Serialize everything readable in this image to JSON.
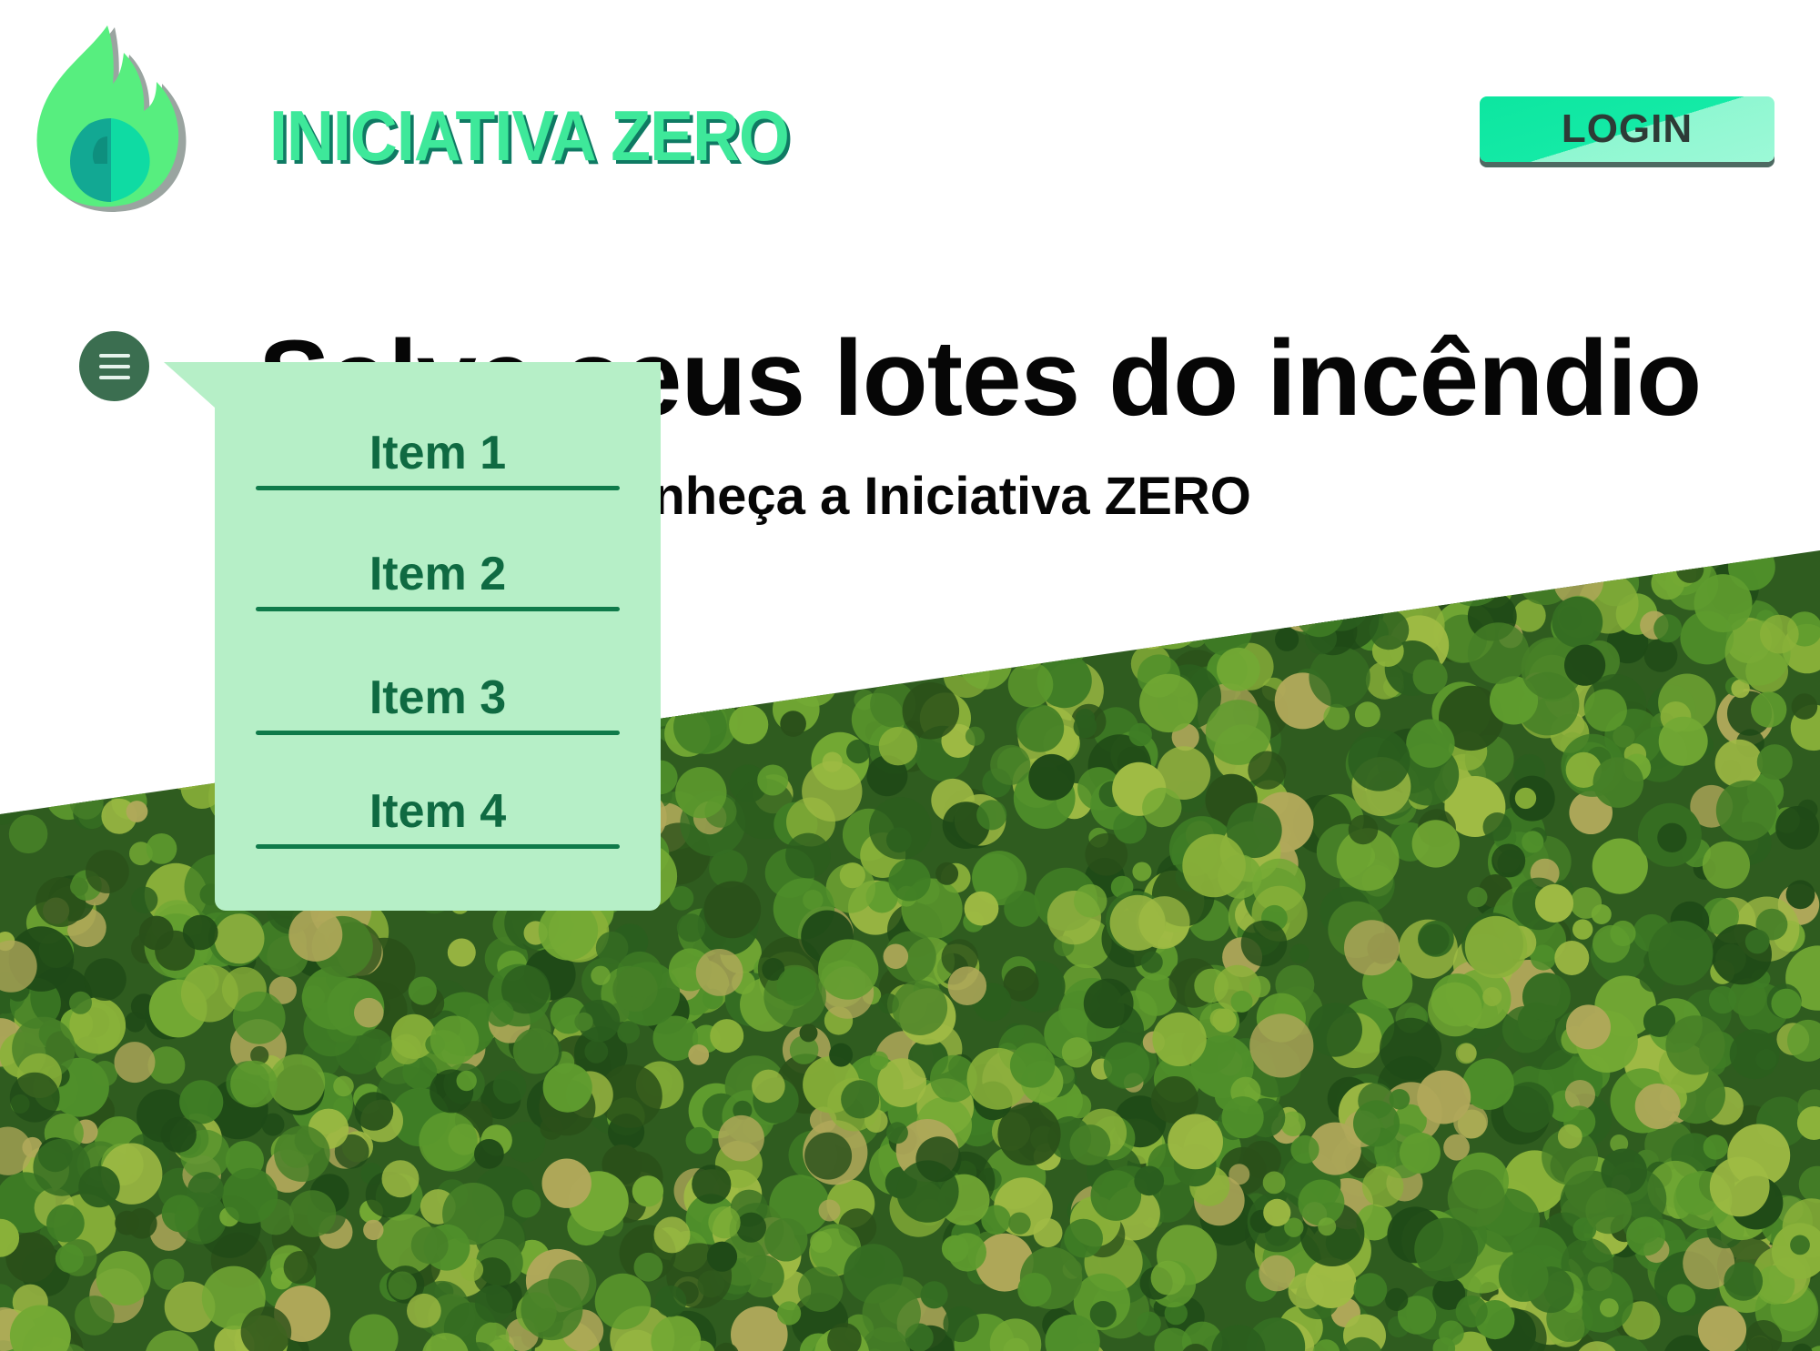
{
  "header": {
    "brand": "INICIATIVA ZERO",
    "login_label": "LOGIN",
    "logo_icon": "flame-logo-icon"
  },
  "hero": {
    "title": "Salve seus lotes do incêndio",
    "subtitle": "Conheça a Iniciativa ZERO"
  },
  "menu": {
    "toggle_icon": "hamburger-menu-icon",
    "items": [
      {
        "label": "Item 1"
      },
      {
        "label": "Item 2"
      },
      {
        "label": "Item 3"
      },
      {
        "label": "Item 4"
      }
    ]
  },
  "colors": {
    "brand_green": "#3ee89a",
    "brand_shadow": "#0f7a63",
    "login_bg": "#14eaa6",
    "menu_button": "#3b6e50",
    "dropdown_bg": "#b6efc7",
    "dropdown_text": "#0f6a42"
  }
}
